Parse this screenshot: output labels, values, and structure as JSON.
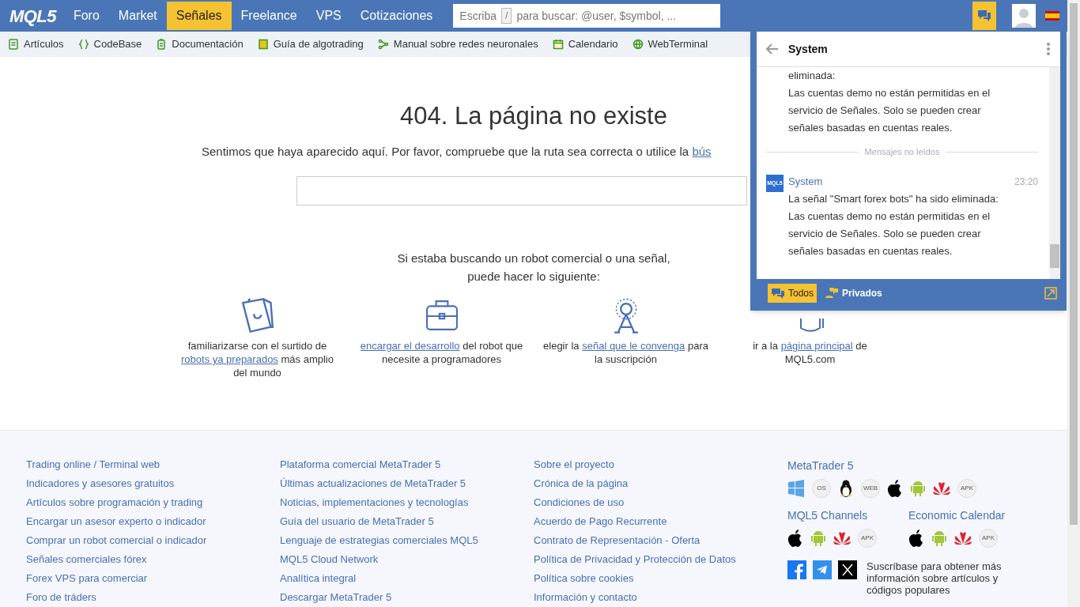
{
  "topnav": {
    "logo": "MQL5",
    "items": [
      {
        "label": "Foro",
        "selected": false
      },
      {
        "label": "Market",
        "selected": false
      },
      {
        "label": "Señales",
        "selected": true
      },
      {
        "label": "Freelance",
        "selected": false
      },
      {
        "label": "VPS",
        "selected": false
      },
      {
        "label": "Cotizaciones",
        "selected": false
      }
    ],
    "search": {
      "placeholder_before": "Escriba",
      "key": "/",
      "placeholder_after": "para buscar: @user, $symbol, ..."
    }
  },
  "subnav": [
    {
      "label": "Artículos"
    },
    {
      "label": "CodeBase"
    },
    {
      "label": "Documentación"
    },
    {
      "label": "Guía de algotrading"
    },
    {
      "label": "Manual sobre redes neuronales"
    },
    {
      "label": "Calendario"
    },
    {
      "label": "WebTerminal"
    }
  ],
  "error": {
    "title": "404. La página no existe",
    "text": "Sentimos que haya aparecido aquí. Por favor, compruebe que la ruta sea correcta o utilice la",
    "link": "bús"
  },
  "suggest": {
    "lines": [
      "Si estaba buscando un robot comercial o una señal,",
      "puede hacer lo siguiente:"
    ],
    "items": [
      {
        "before": "familiarizarse con el surtido de",
        "link": "robots ya preparados",
        "after": "más amplio del mundo"
      },
      {
        "link": "encargar el desarrollo",
        "after": "del robot que necesite a programadores"
      },
      {
        "before": "elegir la",
        "link": "señal que le convenga",
        "after": "para la suscripción"
      },
      {
        "before": "ir a la",
        "link": "página principal",
        "after": "de MQL5.com"
      }
    ]
  },
  "chat": {
    "title": "System",
    "messages": [
      {
        "lines": [
          "eliminada:",
          "Las cuentas demo no están permitidas en el servicio de Señales. Solo se pueden crear señales basadas en cuentas reales."
        ]
      },
      {
        "sender": "System",
        "time": "23:20",
        "lines": [
          "La señal \"Smart forex bots\" ha sido eliminada:",
          "Las cuentas demo no están permitidas en el servicio de Señales. Solo se pueden crear señales basadas en cuentas reales."
        ]
      }
    ],
    "divider": "Mensajes no leídos",
    "avatar": "MQL5",
    "tabs": [
      {
        "label": "Todos",
        "selected": true
      },
      {
        "label": "Privados",
        "selected": false
      }
    ]
  },
  "footer": {
    "columns": [
      [
        "Trading online / Terminal web",
        "Indicadores y asesores gratuitos",
        "Artículos sobre programación y trading",
        "Encargar un asesor experto o indicador",
        "Comprar un robot comercial o indicador",
        "Señales comerciales fórex",
        "Forex VPS para comerciar",
        "Foro de tráders"
      ],
      [
        "Plataforma comercial MetaTrader 5",
        "Últimas actualizaciones de MetaTrader 5",
        "Noticias, implementaciones y tecnologías",
        "Guía del usuario de MetaTrader 5",
        "Lenguaje de estrategias comerciales MQL5",
        "MQL5 Cloud Network",
        "Analítica integral",
        "Descargar MetaTrader 5"
      ],
      [
        "Sobre el proyecto",
        "Crónica de la página",
        "Condiciones de uso",
        "Acuerdo de Pago Recurrente",
        "Contrato de Representación - Oferta",
        "Política de Privacidad y Protección de Datos",
        "Política sobre cookies",
        "Información y contacto"
      ]
    ],
    "apps": [
      {
        "title": "MetaTrader 5",
        "os_badge": "OS",
        "web_badge": "WEB",
        "apk_badge": "APK"
      },
      {
        "title": "MQL5 Channels",
        "apk_badge": "APK"
      },
      {
        "title": "Economic Calendar",
        "apk_badge": "APK"
      }
    ],
    "subscribe": "Suscríbase para obtener más información sobre artículos y códigos populares"
  }
}
